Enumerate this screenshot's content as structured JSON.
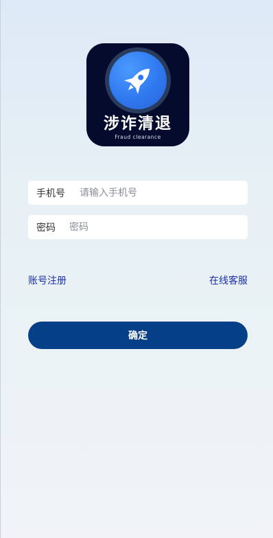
{
  "logo": {
    "title": "涉诈清退",
    "subtitle": "Fraud clearance",
    "icon": "rocket-icon",
    "colors": {
      "background": "#050b2d",
      "circle": "#2f78ef"
    }
  },
  "form": {
    "phone": {
      "label": "手机号",
      "placeholder": "请输入手机号",
      "value": ""
    },
    "password": {
      "label": "密码",
      "placeholder": "密码",
      "value": ""
    }
  },
  "links": {
    "register": "账号注册",
    "service": "在线客服"
  },
  "submit": {
    "label": "确定"
  },
  "colors": {
    "link": "#1b2fa8",
    "button": "#053f87",
    "button_text": "#ffffff"
  }
}
